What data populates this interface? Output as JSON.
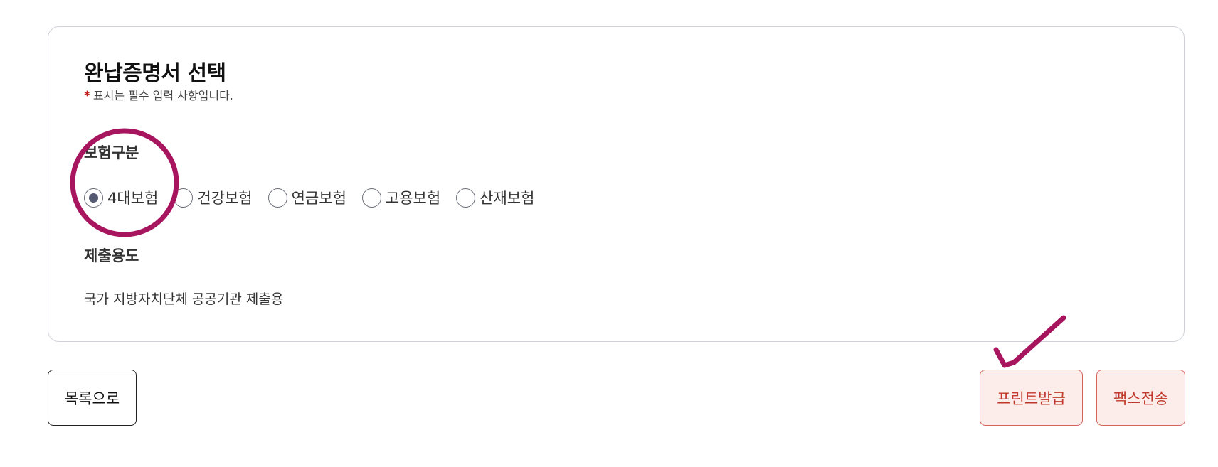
{
  "card": {
    "title": "완납증명서 선택",
    "required_mark": "*",
    "required_note": "표시는 필수 입력 사항입니다."
  },
  "insurance": {
    "label": "보험구분",
    "options": [
      "4대보험",
      "건강보험",
      "연금보험",
      "고용보험",
      "산재보험"
    ],
    "selected": "4대보험"
  },
  "usage": {
    "label": "제출용도",
    "value": "국가 지방자치단체 공공기관 제출용"
  },
  "buttons": {
    "list": "목록으로",
    "print": "프린트발급",
    "fax": "팩스전송"
  },
  "colors": {
    "annotation": "#a8155f",
    "accent_button_text": "#c0392b",
    "accent_button_bg": "#fcecea"
  }
}
